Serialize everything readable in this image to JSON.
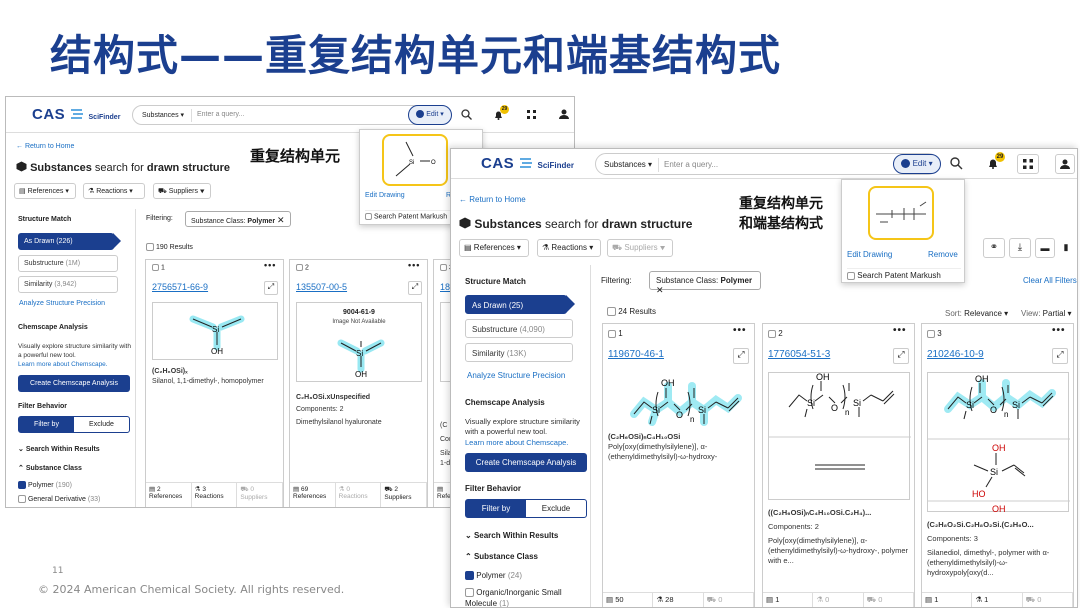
{
  "slide": {
    "title": "结构式——重复结构单元和端基结构式",
    "page_number": "11",
    "copyright": "© 2024 American Chemical Society. All rights reserved."
  },
  "colors": {
    "brand": "#1b3f8f",
    "link": "#1a6fc4",
    "highlight": "#f5c518",
    "molecule_glow": "#7fe3f0"
  },
  "shot1": {
    "logo": "CAS",
    "logo_sub": "SciFinder",
    "substances_dropdown": "Substances ▾",
    "query_placeholder": "Enter a query...",
    "edit_button": "Edit ▾",
    "notifications_count": "29",
    "return_link": "← Return to Home",
    "title_bold": "Substances",
    "title_rest": " search for ",
    "title_bold2": "drawn structure",
    "toolbar": {
      "references": "References ▾",
      "reactions": "Reactions ▾",
      "suppliers": "Suppliers ▾"
    },
    "structure_match": {
      "heading": "Structure Match",
      "items": [
        {
          "label": "As Drawn",
          "count": "(226)"
        },
        {
          "label": "Substructure",
          "count": "(1M)"
        },
        {
          "label": "Similarity",
          "count": "(3,942)"
        }
      ],
      "analyze_link": "Analyze Structure Precision"
    },
    "chemscape": {
      "heading": "Chemscape Analysis",
      "description": "Visually explore structure similarity with a powerful new tool.",
      "learn_more": "Learn more about Chemscape.",
      "button": "Create Chemscape Analysis"
    },
    "filter_behavior": {
      "heading": "Filter Behavior",
      "filter_by": "Filter by",
      "exclude": "Exclude"
    },
    "search_within": "Search Within Results",
    "substance_class": {
      "heading": "Substance Class",
      "items": [
        {
          "label": "Polymer",
          "count": "(190)",
          "checked": true
        },
        {
          "label": "General Derivative",
          "count": "(33)",
          "checked": false
        }
      ]
    },
    "filtering_label": "Filtering:",
    "filter_chip": "Substance Class: ",
    "filter_chip_value": "Polymer",
    "results_count": "190 Results",
    "popup": {
      "si_label": "Si",
      "o_label": "O",
      "edit_drawing": "Edit Drawing",
      "remove": "Re",
      "search_patent": "Search Patent Markush"
    },
    "annotation": "重复结构单元",
    "cards": [
      {
        "num": "1",
        "cas": "2756571-66-9",
        "formula": "(C₂H₆OSi)ₓ",
        "name": "Silanol, 1,1-dimethyl-, homopolymer",
        "si": "Si",
        "oh": "OH",
        "footer": [
          {
            "n": "2",
            "label": "References"
          },
          {
            "n": "3",
            "label": "Reactions"
          },
          {
            "n": "0",
            "label": "Suppliers",
            "dis": true
          }
        ]
      },
      {
        "num": "2",
        "cas": "135507-00-5",
        "cas_inner": "9004-61-9",
        "not_available": "Image Not Available",
        "formula": "C₂H₈OSi.xUnspecified",
        "components": "Components: 2",
        "name": "Dimethylsilanol hyaluronate",
        "si": "Si",
        "oh": "OH",
        "footer": [
          {
            "n": "69",
            "label": "References"
          },
          {
            "n": "0",
            "label": "Reactions",
            "dis": true
          },
          {
            "n": "2",
            "label": "Suppliers"
          }
        ]
      },
      {
        "num": "3",
        "cas": "183",
        "partial_lines": [
          "(C",
          "Com",
          "Silar",
          "1-di"
        ],
        "footer": [
          {
            "n": "",
            "label": "Refe"
          }
        ]
      }
    ]
  },
  "shot2": {
    "logo": "CAS",
    "logo_sub": "SciFinder",
    "substances_dropdown": "Substances ▾",
    "query_placeholder": "Enter a query...",
    "edit_button": "Edit ▾",
    "notifications_count": "29",
    "return_link": "← Return to Home",
    "title_bold": "Substances",
    "title_rest": " search for ",
    "title_bold2": "drawn structure",
    "toolbar": {
      "references": "References ▾",
      "reactions": "Reactions ▾",
      "suppliers": "Suppliers ▾"
    },
    "structure_match": {
      "heading": "Structure Match",
      "items": [
        {
          "label": "As Drawn",
          "count": "(25)"
        },
        {
          "label": "Substructure",
          "count": "(4,090)"
        },
        {
          "label": "Similarity",
          "count": "(13K)"
        }
      ],
      "analyze_link": "Analyze Structure Precision"
    },
    "chemscape": {
      "heading": "Chemscape Analysis",
      "description": "Visually explore structure similarity with a powerful new tool.",
      "learn_more": "Learn more about Chemscape.",
      "button": "Create Chemscape Analysis"
    },
    "filter_behavior": {
      "heading": "Filter Behavior",
      "filter_by": "Filter by",
      "exclude": "Exclude"
    },
    "search_within": "Search Within Results",
    "substance_class": {
      "heading": "Substance Class",
      "items": [
        {
          "label": "Polymer",
          "count": "(24)",
          "checked": true
        },
        {
          "label": "Organic/Inorganic Small Molecule",
          "count": "(1)",
          "checked": false
        }
      ]
    },
    "filtering_label": "Filtering:",
    "filter_chip": "Substance Class: ",
    "filter_chip_value": "Polymer",
    "clear_all": "Clear All Filters",
    "results_count": "24 Results",
    "sort_label": "Sort:",
    "sort_value": "Relevance ▾",
    "view_label": "View:",
    "view_value": "Partial ▾",
    "popup": {
      "edit_drawing": "Edit Drawing",
      "remove": "Remove",
      "search_patent": "Search Patent Markush"
    },
    "annotation_line1": "重复结构单元",
    "annotation_line2": "和端基结构式",
    "cards": [
      {
        "num": "1",
        "cas": "119670-46-1",
        "formula": "(C₂H₆OSi)ₙC₄H₁₀OSi",
        "name": "Poly[oxy(dimethylsilylene)], α-(ethenyldimethylsilyl)-ω-hydroxy-",
        "si": "Si",
        "o": "O",
        "oh": "OH",
        "n": "n",
        "footer": [
          {
            "n": "50"
          },
          {
            "n": "28"
          },
          {
            "n": "0",
            "dis": true
          }
        ]
      },
      {
        "num": "2",
        "cas": "1776054-51-3",
        "formula": "((C₂H₆OSi)ₙC₄H₁₀OSi.C₂H₄)...",
        "components": "Components: 2",
        "name": "Poly[oxy(dimethylsilylene)], α-(ethenyldimethylsilyl)-ω-hydroxy-, polymer with e...",
        "si": "Si",
        "o": "O",
        "oh": "OH",
        "n": "n",
        "footer": [
          {
            "n": "1"
          },
          {
            "n": "0",
            "dis": true
          },
          {
            "n": "0",
            "dis": true
          }
        ]
      },
      {
        "num": "3",
        "cas": "210246-10-9",
        "formula": "(C₂H₈O₂Si.C₂H₈O₂Si.(C₂H₆O...",
        "components": "Components: 3",
        "name": "Silanediol, dimethyl-, polymer with α-(ethenyldimethylsilyl)-ω-hydroxypoly[oxy(d...",
        "si": "Si",
        "o": "O",
        "oh": "OH",
        "ho": "HO",
        "n": "n",
        "footer": [
          {
            "n": "1"
          },
          {
            "n": "1"
          },
          {
            "n": "0",
            "dis": true
          }
        ]
      }
    ]
  }
}
